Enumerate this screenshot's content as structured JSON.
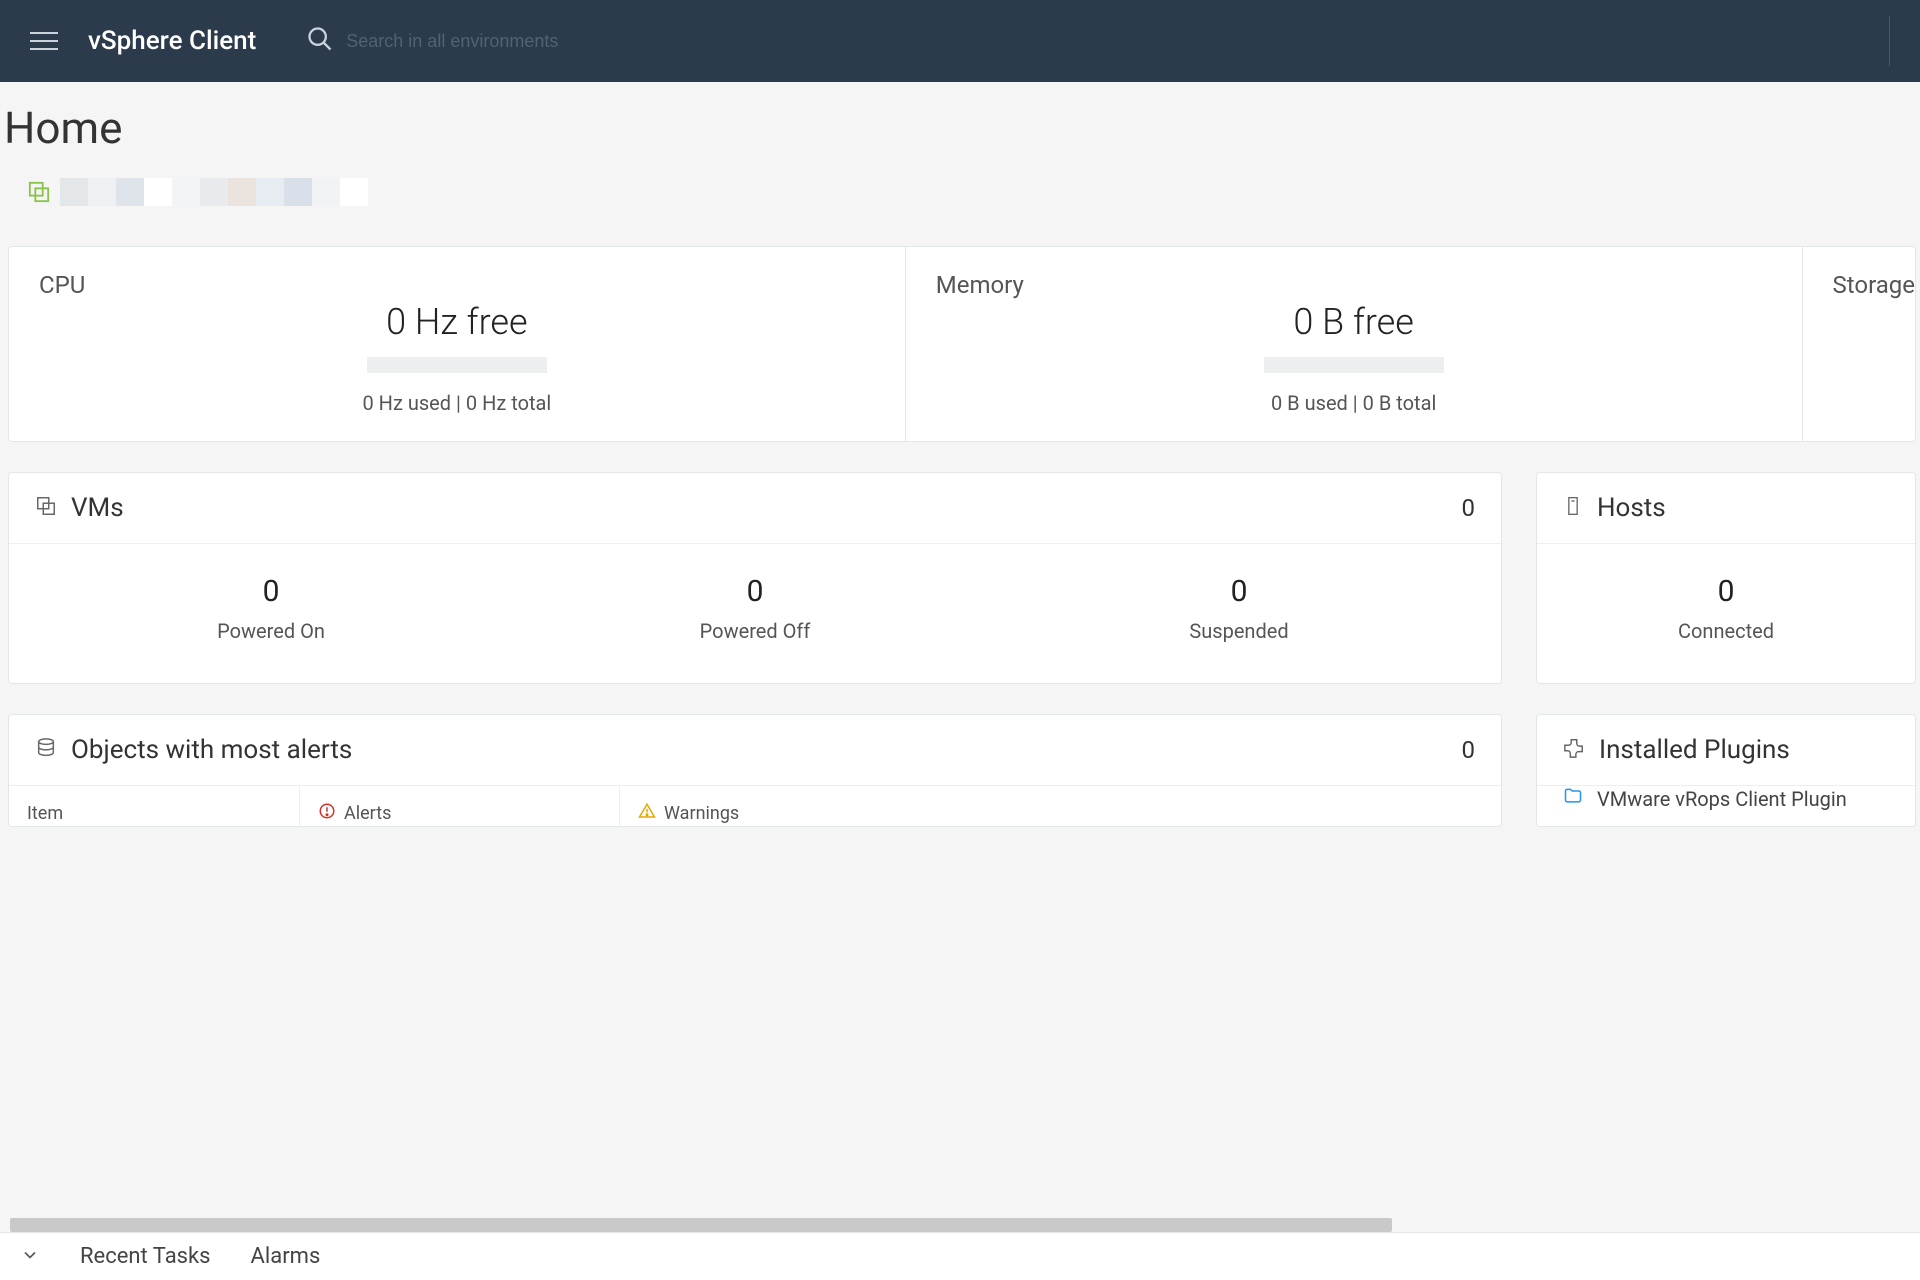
{
  "navbar": {
    "brand": "vSphere Client",
    "search_placeholder": "Search in all environments"
  },
  "page": {
    "title": "Home"
  },
  "resources": {
    "cpu": {
      "label": "CPU",
      "free": "0 Hz free",
      "sub": "0 Hz used | 0 Hz total"
    },
    "memory": {
      "label": "Memory",
      "free": "0 B free",
      "sub": "0 B used | 0 B total"
    },
    "storage": {
      "label": "Storage"
    }
  },
  "vms": {
    "title": "VMs",
    "count": "0",
    "stats": [
      {
        "num": "0",
        "label": "Powered On"
      },
      {
        "num": "0",
        "label": "Powered Off"
      },
      {
        "num": "0",
        "label": "Suspended"
      }
    ]
  },
  "hosts": {
    "title": "Hosts",
    "stats": [
      {
        "num": "0",
        "label": "Connected"
      }
    ]
  },
  "alerts": {
    "title": "Objects with most alerts",
    "count": "0",
    "columns": {
      "item": "Item",
      "alerts": "Alerts",
      "warnings": "Warnings"
    }
  },
  "plugins": {
    "title": "Installed Plugins",
    "items": [
      "VMware vRops Client Plugin"
    ]
  },
  "bottom": {
    "recent_tasks": "Recent Tasks",
    "alarms": "Alarms"
  }
}
